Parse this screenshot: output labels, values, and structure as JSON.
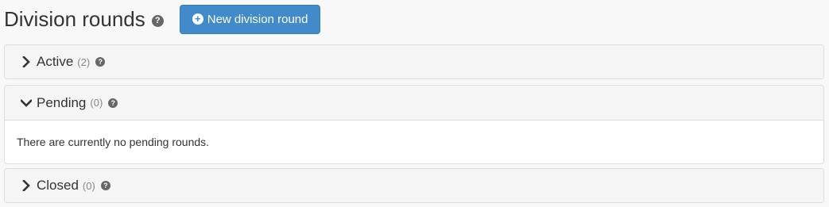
{
  "header": {
    "title": "Division rounds",
    "help_glyph": "?",
    "new_button_icon": "+",
    "new_button_label": "New division round"
  },
  "panels": [
    {
      "title": "Active",
      "count": "(2)",
      "expanded": false,
      "chevron": "chevron-right-icon"
    },
    {
      "title": "Pending",
      "count": "(0)",
      "expanded": true,
      "chevron": "chevron-down-icon",
      "body_text": "There are currently no pending rounds."
    },
    {
      "title": "Closed",
      "count": "(0)",
      "expanded": false,
      "chevron": "chevron-right-icon"
    }
  ],
  "colors": {
    "primary": "#428bca",
    "panel_heading_bg": "#f5f5f5",
    "border": "#dddddd",
    "page_bg": "#f8f8f8"
  }
}
